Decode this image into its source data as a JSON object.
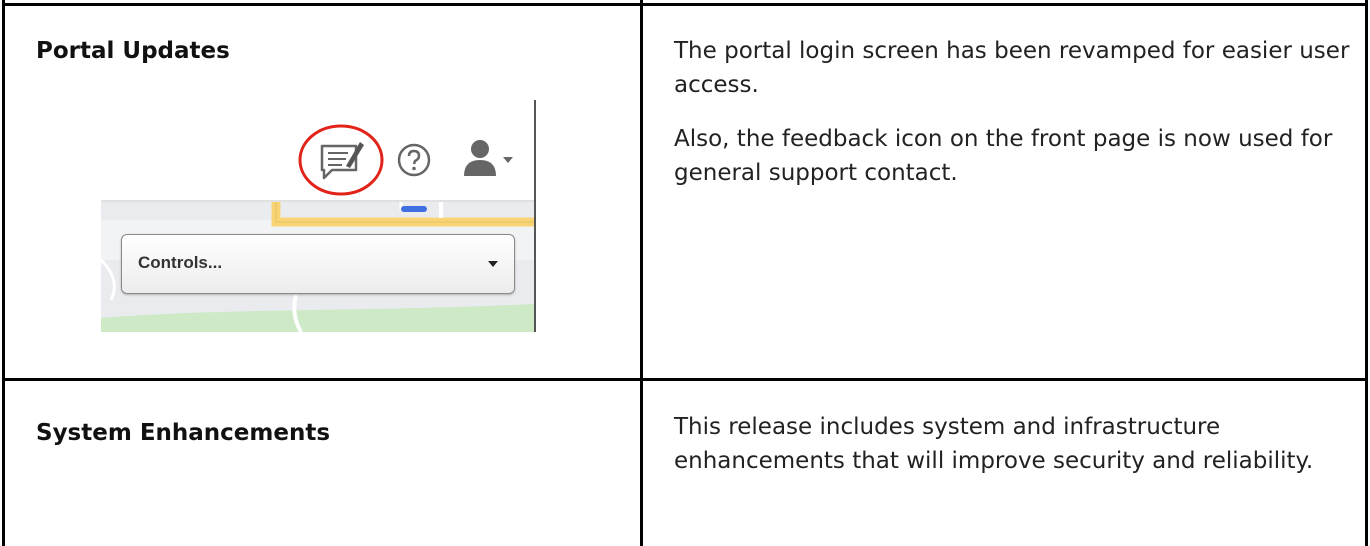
{
  "rows": [
    {
      "heading": "Portal Updates",
      "paragraphs": [
        "The portal login screen has been revamped for easier user access.",
        "Also, the feedback icon on the front page is now used for general support contact."
      ]
    },
    {
      "heading": "System Enhancements",
      "paragraphs": [
        "This release includes system and infrastructure enhancements that will improve security and reliability."
      ]
    }
  ],
  "screenshot": {
    "icons": [
      "feedback-icon",
      "help-icon",
      "user-icon",
      "chevron-down-icon"
    ],
    "highlight_color": "#e2231a",
    "controls_label": "Controls...",
    "map_colors": {
      "road": "#f8d476",
      "park": "#cde9c6",
      "land": "#e9ebee"
    }
  }
}
